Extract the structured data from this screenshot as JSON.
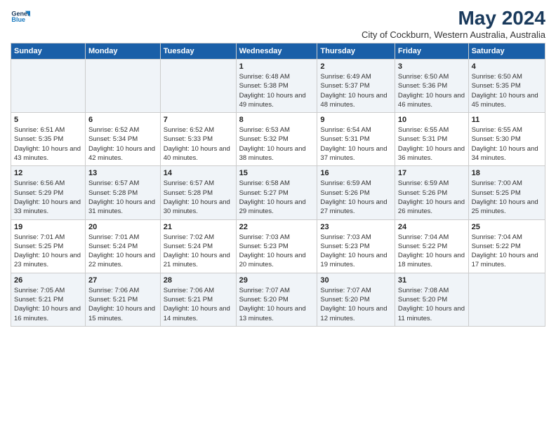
{
  "logo": {
    "line1": "General",
    "line2": "Blue"
  },
  "title": "May 2024",
  "subtitle": "City of Cockburn, Western Australia, Australia",
  "days_of_week": [
    "Sunday",
    "Monday",
    "Tuesday",
    "Wednesday",
    "Thursday",
    "Friday",
    "Saturday"
  ],
  "weeks": [
    [
      {
        "day": "",
        "info": ""
      },
      {
        "day": "",
        "info": ""
      },
      {
        "day": "",
        "info": ""
      },
      {
        "day": "1",
        "info": "Sunrise: 6:48 AM\nSunset: 5:38 PM\nDaylight: 10 hours and 49 minutes."
      },
      {
        "day": "2",
        "info": "Sunrise: 6:49 AM\nSunset: 5:37 PM\nDaylight: 10 hours and 48 minutes."
      },
      {
        "day": "3",
        "info": "Sunrise: 6:50 AM\nSunset: 5:36 PM\nDaylight: 10 hours and 46 minutes."
      },
      {
        "day": "4",
        "info": "Sunrise: 6:50 AM\nSunset: 5:35 PM\nDaylight: 10 hours and 45 minutes."
      }
    ],
    [
      {
        "day": "5",
        "info": "Sunrise: 6:51 AM\nSunset: 5:35 PM\nDaylight: 10 hours and 43 minutes."
      },
      {
        "day": "6",
        "info": "Sunrise: 6:52 AM\nSunset: 5:34 PM\nDaylight: 10 hours and 42 minutes."
      },
      {
        "day": "7",
        "info": "Sunrise: 6:52 AM\nSunset: 5:33 PM\nDaylight: 10 hours and 40 minutes."
      },
      {
        "day": "8",
        "info": "Sunrise: 6:53 AM\nSunset: 5:32 PM\nDaylight: 10 hours and 38 minutes."
      },
      {
        "day": "9",
        "info": "Sunrise: 6:54 AM\nSunset: 5:31 PM\nDaylight: 10 hours and 37 minutes."
      },
      {
        "day": "10",
        "info": "Sunrise: 6:55 AM\nSunset: 5:31 PM\nDaylight: 10 hours and 36 minutes."
      },
      {
        "day": "11",
        "info": "Sunrise: 6:55 AM\nSunset: 5:30 PM\nDaylight: 10 hours and 34 minutes."
      }
    ],
    [
      {
        "day": "12",
        "info": "Sunrise: 6:56 AM\nSunset: 5:29 PM\nDaylight: 10 hours and 33 minutes."
      },
      {
        "day": "13",
        "info": "Sunrise: 6:57 AM\nSunset: 5:28 PM\nDaylight: 10 hours and 31 minutes."
      },
      {
        "day": "14",
        "info": "Sunrise: 6:57 AM\nSunset: 5:28 PM\nDaylight: 10 hours and 30 minutes."
      },
      {
        "day": "15",
        "info": "Sunrise: 6:58 AM\nSunset: 5:27 PM\nDaylight: 10 hours and 29 minutes."
      },
      {
        "day": "16",
        "info": "Sunrise: 6:59 AM\nSunset: 5:26 PM\nDaylight: 10 hours and 27 minutes."
      },
      {
        "day": "17",
        "info": "Sunrise: 6:59 AM\nSunset: 5:26 PM\nDaylight: 10 hours and 26 minutes."
      },
      {
        "day": "18",
        "info": "Sunrise: 7:00 AM\nSunset: 5:25 PM\nDaylight: 10 hours and 25 minutes."
      }
    ],
    [
      {
        "day": "19",
        "info": "Sunrise: 7:01 AM\nSunset: 5:25 PM\nDaylight: 10 hours and 23 minutes."
      },
      {
        "day": "20",
        "info": "Sunrise: 7:01 AM\nSunset: 5:24 PM\nDaylight: 10 hours and 22 minutes."
      },
      {
        "day": "21",
        "info": "Sunrise: 7:02 AM\nSunset: 5:24 PM\nDaylight: 10 hours and 21 minutes."
      },
      {
        "day": "22",
        "info": "Sunrise: 7:03 AM\nSunset: 5:23 PM\nDaylight: 10 hours and 20 minutes."
      },
      {
        "day": "23",
        "info": "Sunrise: 7:03 AM\nSunset: 5:23 PM\nDaylight: 10 hours and 19 minutes."
      },
      {
        "day": "24",
        "info": "Sunrise: 7:04 AM\nSunset: 5:22 PM\nDaylight: 10 hours and 18 minutes."
      },
      {
        "day": "25",
        "info": "Sunrise: 7:04 AM\nSunset: 5:22 PM\nDaylight: 10 hours and 17 minutes."
      }
    ],
    [
      {
        "day": "26",
        "info": "Sunrise: 7:05 AM\nSunset: 5:21 PM\nDaylight: 10 hours and 16 minutes."
      },
      {
        "day": "27",
        "info": "Sunrise: 7:06 AM\nSunset: 5:21 PM\nDaylight: 10 hours and 15 minutes."
      },
      {
        "day": "28",
        "info": "Sunrise: 7:06 AM\nSunset: 5:21 PM\nDaylight: 10 hours and 14 minutes."
      },
      {
        "day": "29",
        "info": "Sunrise: 7:07 AM\nSunset: 5:20 PM\nDaylight: 10 hours and 13 minutes."
      },
      {
        "day": "30",
        "info": "Sunrise: 7:07 AM\nSunset: 5:20 PM\nDaylight: 10 hours and 12 minutes."
      },
      {
        "day": "31",
        "info": "Sunrise: 7:08 AM\nSunset: 5:20 PM\nDaylight: 10 hours and 11 minutes."
      },
      {
        "day": "",
        "info": ""
      }
    ]
  ]
}
